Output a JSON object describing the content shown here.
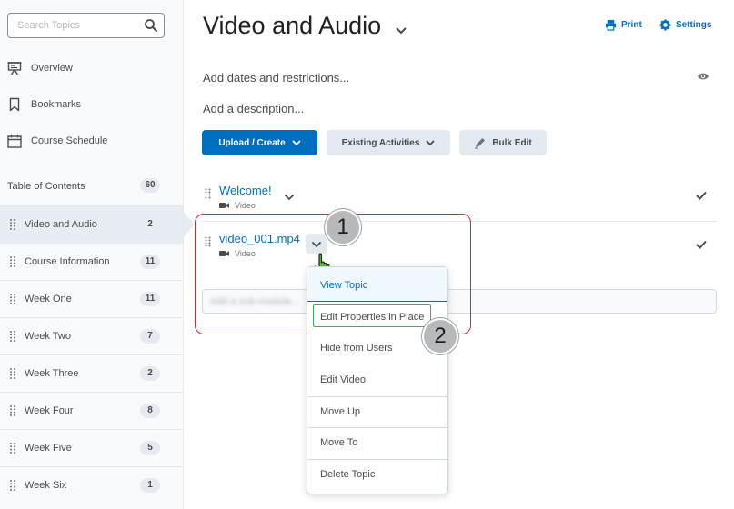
{
  "sidebar": {
    "search_placeholder": "Search Topics",
    "nav": [
      {
        "label": "Overview",
        "icon": "presentation-icon"
      },
      {
        "label": "Bookmarks",
        "icon": "bookmark-icon"
      },
      {
        "label": "Course Schedule",
        "icon": "calendar-icon"
      }
    ],
    "toc": {
      "label": "Table of Contents",
      "count": "60"
    },
    "modules": [
      {
        "label": "Video and Audio",
        "count": "2",
        "selected": true
      },
      {
        "label": "Course Information",
        "count": "11"
      },
      {
        "label": "Week One",
        "count": "11"
      },
      {
        "label": "Week Two",
        "count": "7"
      },
      {
        "label": "Week Three",
        "count": "2"
      },
      {
        "label": "Week Four",
        "count": "8"
      },
      {
        "label": "Week Five",
        "count": "5"
      },
      {
        "label": "Week Six",
        "count": "1"
      }
    ]
  },
  "header": {
    "title": "Video and Audio",
    "print_label": "Print",
    "settings_label": "Settings"
  },
  "main": {
    "dates_label": "Add dates and restrictions...",
    "description_label": "Add a description...",
    "upload_label": "Upload / Create",
    "existing_label": "Existing Activities",
    "bulk_edit_label": "Bulk Edit",
    "topics": [
      {
        "title": "Welcome!",
        "type": "Video"
      },
      {
        "title": "video_001.mp4",
        "type": "Video"
      }
    ],
    "submodule_placeholder": "Add a sub-module..."
  },
  "menu": {
    "items": [
      "View Topic",
      "Edit Properties in Place",
      "Hide from Users",
      "Edit Video",
      "Move Up",
      "Move To",
      "Delete Topic"
    ]
  },
  "annotations": {
    "step1": "1",
    "step2": "2"
  },
  "colors": {
    "accent": "#006fbf",
    "highlight_border": "#d9232e",
    "menu_item_frame": "#46a661"
  }
}
